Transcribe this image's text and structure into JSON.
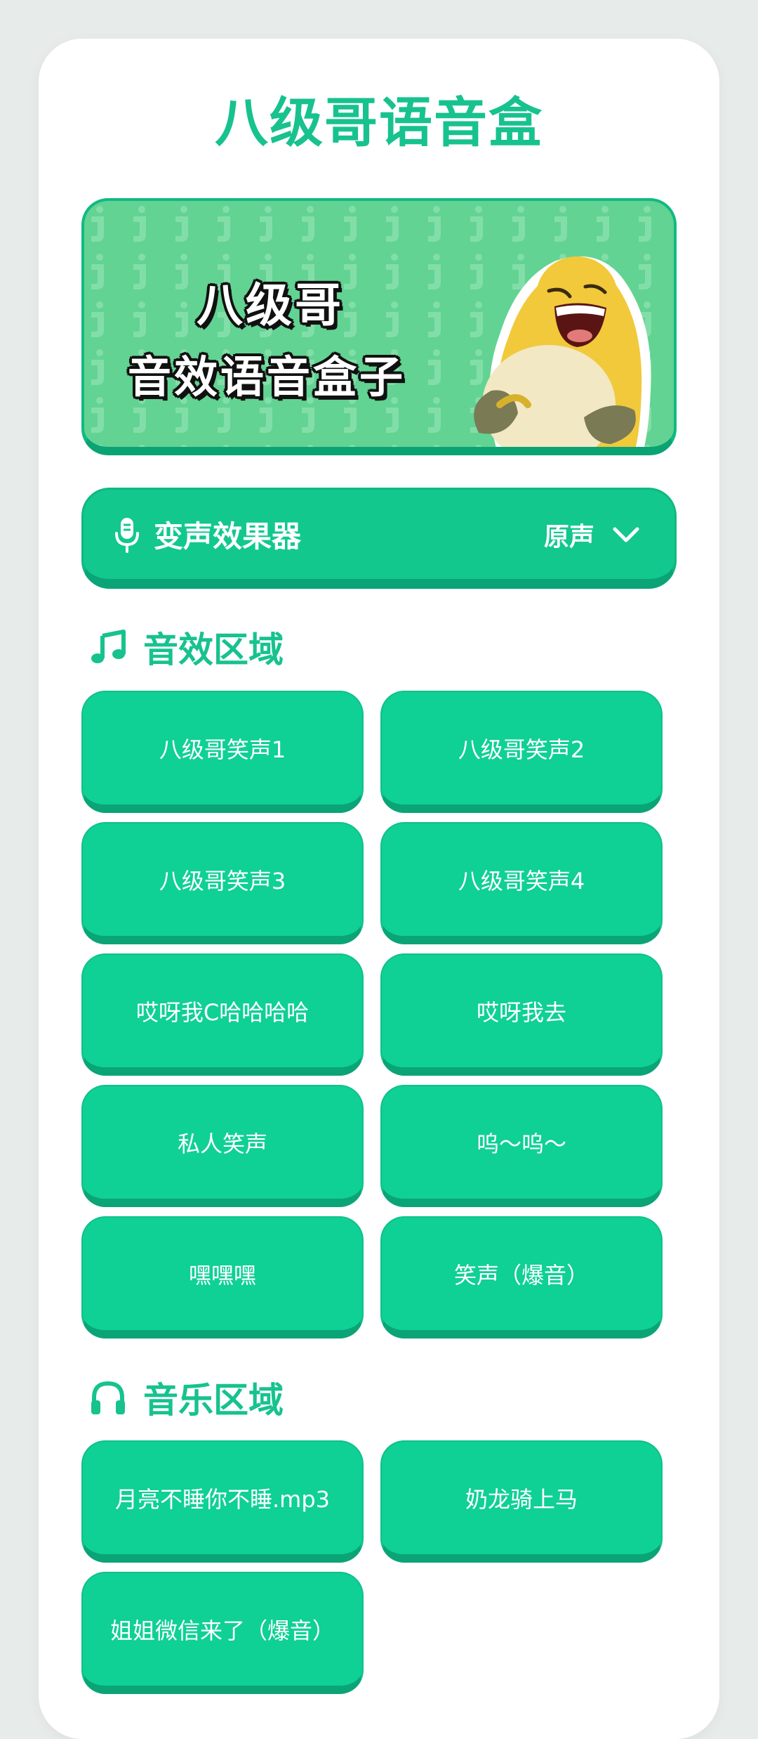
{
  "app": {
    "title": "八级哥语音盒"
  },
  "banner": {
    "line1": "八级哥",
    "line2": "音效语音盒子"
  },
  "voice_changer": {
    "label": "变声效果器",
    "value": "原声",
    "icon": "microphone-icon",
    "dropdown_icon": "chevron-down-icon"
  },
  "sections": {
    "effects": {
      "title": "音效区域",
      "icon": "music-note-icon",
      "buttons": [
        "八级哥笑声1",
        "八级哥笑声2",
        "八级哥笑声3",
        "八级哥笑声4",
        "哎呀我C哈哈哈哈",
        "哎呀我去",
        "私人笑声",
        "呜～呜～",
        "嘿嘿嘿",
        "笑声（爆音）"
      ]
    },
    "music": {
      "title": "音乐区域",
      "icon": "headphones-icon",
      "buttons": [
        "月亮不睡你不睡.mp3",
        "奶龙骑上马",
        "姐姐微信来了（爆音）"
      ]
    }
  },
  "colors": {
    "accent": "#17c28e",
    "button": "#0fd095",
    "button_shadow": "#0aa477",
    "banner_bg": "#62d392",
    "page_bg": "#e7ecea"
  }
}
